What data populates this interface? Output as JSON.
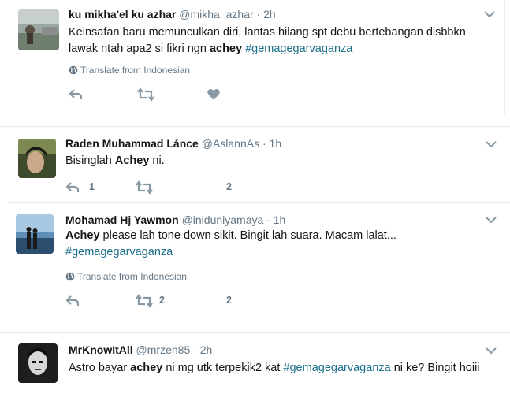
{
  "tweets": [
    {
      "name": "ku mikha'el ku azhar",
      "handle": "@mikha_azhar",
      "sep": "·",
      "time": "2h",
      "body_parts": [
        "Keinsafan baru memunculkan diri, lantas hilang spt debu bertebangan disbbkn lawak ntah apa2 si fikri ngn ",
        "achey",
        " ",
        "#gemagegarvaganza"
      ],
      "translate": "Translate from Indonesian",
      "reply_count": "",
      "retweet_count": "",
      "like_count": ""
    },
    {
      "name": "Raden Muhammad Lánce",
      "handle": "@AslannAs",
      "sep": "·",
      "time": "1h",
      "body_parts": [
        "Bisinglah ",
        "Achey",
        " ni."
      ],
      "reply_count": "1",
      "retweet_count": "",
      "like_count": "2"
    },
    {
      "name": "Mohamad Hj Yawmon",
      "handle": "@iniduniyamaya",
      "sep": "·",
      "time": "1h",
      "body_parts": [
        "Achey",
        " please lah tone down sikit. Bingit lah suara. Macam lalat...",
        "#gemagegarvaganza"
      ],
      "translate": "Translate from Indonesian",
      "reply_count": "",
      "retweet_count": "2",
      "like_count": "2"
    },
    {
      "name": "MrKnowItAll",
      "handle": "@mrzen85",
      "sep": "·",
      "time": "2h",
      "body_parts": [
        "Astro bayar ",
        "achey",
        " ni mg utk terpekik2 kat ",
        "#gemagegarvaganza",
        " ni ke? Bingit hoiii"
      ]
    }
  ],
  "colors": {
    "hashtag": "#1b6f8a",
    "icon": "#8899a6",
    "text": "#14171a",
    "muted": "#657786"
  }
}
